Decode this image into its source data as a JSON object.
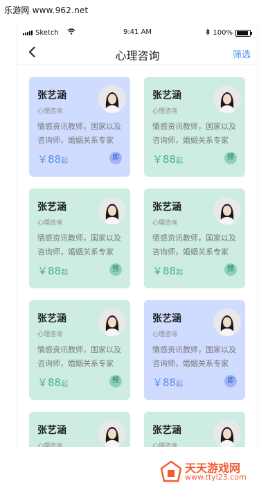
{
  "site": {
    "label": "乐游网 www.962.net"
  },
  "statusbar": {
    "carrier": "Sketch",
    "time": "9:41 AM",
    "battery": "100%"
  },
  "navbar": {
    "title": "心理咨询",
    "filter": "筛选"
  },
  "colors": {
    "green_card": "#cdece2",
    "blue_card": "#cfdbff",
    "accent_blue": "#4a8df3",
    "watermark": "#ef5c31"
  },
  "cards": [
    {
      "name": "张艺涵",
      "subtitle": "心理咨询",
      "desc": "情感资讯教师，国家以及咨询师，婚姻关系专家",
      "price": "￥88",
      "unit": "起",
      "tag": "即"
    },
    {
      "name": "张艺涵",
      "subtitle": "心理咨询",
      "desc": "情感资讯教师，国家以及咨询师，婚姻关系专家",
      "price": "￥88",
      "unit": "起",
      "tag": "预"
    },
    {
      "name": "张艺涵",
      "subtitle": "心理咨询",
      "desc": "情感资讯教师，国家以及咨询师，婚姻关系专家",
      "price": "￥88",
      "unit": "起",
      "tag": "预"
    },
    {
      "name": "张艺涵",
      "subtitle": "心理咨询",
      "desc": "情感资讯教师，国家以及咨询师，婚姻关系专家",
      "price": "￥88",
      "unit": "起",
      "tag": "预"
    },
    {
      "name": "张艺涵",
      "subtitle": "心理咨询",
      "desc": "情感资讯教师，国家以及咨询师，婚姻关系专家",
      "price": "￥88",
      "unit": "起",
      "tag": "预"
    },
    {
      "name": "张艺涵",
      "subtitle": "心理咨询",
      "desc": "情感资讯教师，国家以及咨询师，婚姻关系专家",
      "price": "￥88",
      "unit": "起",
      "tag": "即"
    },
    {
      "name": "张艺涵",
      "subtitle": "心理咨询",
      "desc": "",
      "price": "",
      "unit": "",
      "tag": ""
    },
    {
      "name": "张艺涵",
      "subtitle": "心理咨询",
      "desc": "",
      "price": "",
      "unit": "",
      "tag": ""
    }
  ],
  "watermark": {
    "title": "天天游戏网",
    "url": "www.ttyl23.com"
  }
}
